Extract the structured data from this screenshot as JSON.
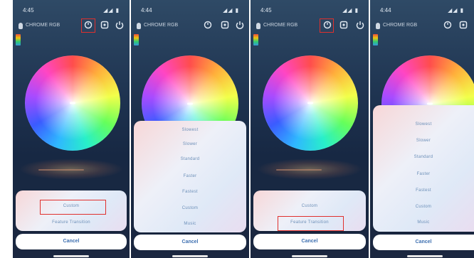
{
  "status": {
    "time_a": "4:45",
    "time_b": "4:44",
    "signal": "◢◢ ▮"
  },
  "device": {
    "name": "CHROME RGB"
  },
  "icons": {
    "power": "power-icon",
    "timer": "timer-icon",
    "settings": "settings-icon"
  },
  "wheel": {
    "center_label": "· · ·"
  },
  "sheet_short": {
    "items": [
      "Custom",
      "Feature Transition"
    ]
  },
  "sheet_long": {
    "items": [
      "Slowest",
      "Slower",
      "Standard",
      "Faster",
      "Fastest",
      "Custom",
      "Music"
    ]
  },
  "cancel": {
    "label": "Cancel"
  },
  "colors": {
    "accent": "#3d6fb0",
    "highlight": "#e0302d"
  }
}
